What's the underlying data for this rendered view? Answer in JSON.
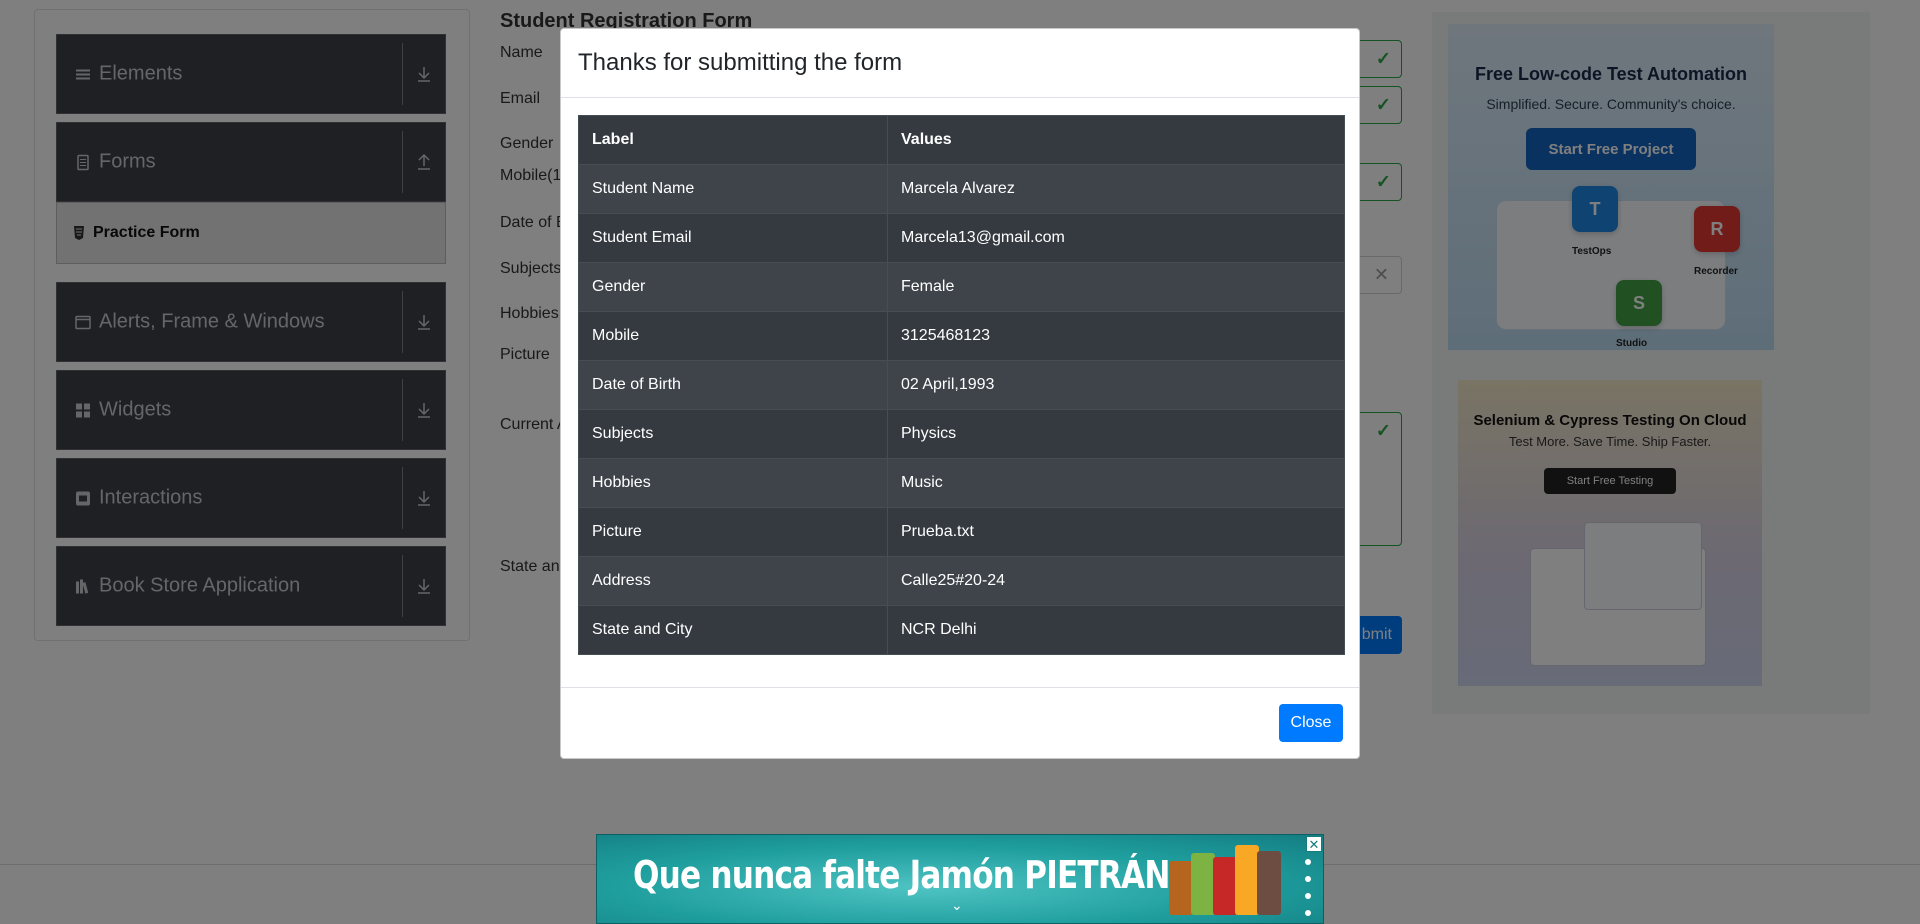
{
  "sidebar": {
    "groups": [
      {
        "label": "Elements",
        "icon": "menu-icon",
        "arrow": "download-arrow-icon"
      },
      {
        "label": "Forms",
        "icon": "document-icon",
        "arrow": "upload-arrow-icon"
      },
      {
        "label": "Alerts, Frame & Windows",
        "icon": "window-icon",
        "arrow": "download-arrow-icon"
      },
      {
        "label": "Widgets",
        "icon": "widgets-icon",
        "arrow": "download-arrow-icon"
      },
      {
        "label": "Interactions",
        "icon": "interaction-icon",
        "arrow": "download-arrow-icon"
      },
      {
        "label": "Book Store Application",
        "icon": "books-icon",
        "arrow": "download-arrow-icon"
      }
    ],
    "active_item": "Practice Form"
  },
  "form": {
    "title": "Student Registration Form",
    "labels": {
      "name": "Name",
      "email": "Email",
      "gender": "Gender",
      "mobile": "Mobile(1",
      "dob": "Date of B",
      "subjects": "Subjects",
      "hobbies": "Hobbies",
      "picture": "Picture",
      "address": "Current A",
      "state": "State and"
    },
    "submit_label": "bmit"
  },
  "modal": {
    "title": "Thanks for submitting the form",
    "table": {
      "headers": [
        "Label",
        "Values"
      ],
      "rows": [
        [
          "Student Name",
          "Marcela Alvarez"
        ],
        [
          "Student Email",
          "Marcela13@gmail.com"
        ],
        [
          "Gender",
          "Female"
        ],
        [
          "Mobile",
          "3125468123"
        ],
        [
          "Date of Birth",
          "02 April,1993"
        ],
        [
          "Subjects",
          "Physics"
        ],
        [
          "Hobbies",
          "Music"
        ],
        [
          "Picture",
          "Prueba.txt"
        ],
        [
          "Address",
          "Calle25#20-24"
        ],
        [
          "State and City",
          "NCR Delhi"
        ]
      ]
    },
    "close_label": "Close"
  },
  "ads": {
    "right_top": {
      "headline": "Free Low-code Test Automation",
      "subline": "Simplified. Secure. Community's choice.",
      "button": "Start Free Project",
      "tiles": [
        "TestOps",
        "Recorder",
        "Studio"
      ]
    },
    "right_bottom": {
      "headline": "Selenium & Cypress Testing On Cloud",
      "subline": "Test More. Save Time. Ship Faster.",
      "button": "Start Free Testing"
    },
    "bottom_banner": {
      "text": "Que nunca falte Jamón PIETRÁN",
      "close": "✕"
    }
  },
  "colors": {
    "primary": "#007bff",
    "sidebar_bg": "#3c4148",
    "table_dark": "#343a40",
    "valid_green": "#28a745"
  }
}
